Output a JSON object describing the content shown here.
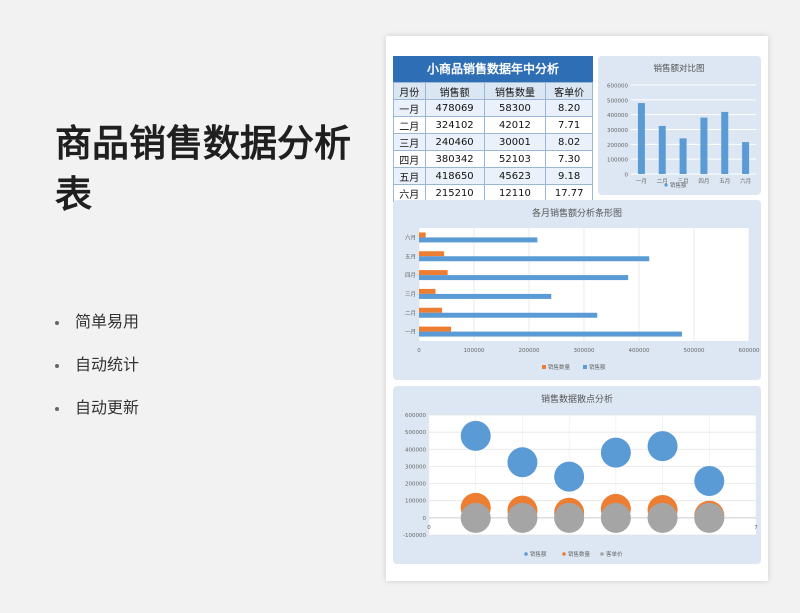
{
  "page": {
    "title": "商品销售数据分析表",
    "features": [
      "简单易用",
      "自动统计",
      "自动更新"
    ]
  },
  "table": {
    "title": "小商品销售数据年中分析",
    "headers": [
      "月份",
      "销售额",
      "销售数量",
      "客单价"
    ],
    "rows": [
      [
        "一月",
        "478069",
        "58300",
        "8.20"
      ],
      [
        "二月",
        "324102",
        "42012",
        "7.71"
      ],
      [
        "三月",
        "240460",
        "30001",
        "8.02"
      ],
      [
        "四月",
        "380342",
        "52103",
        "7.30"
      ],
      [
        "五月",
        "418650",
        "45623",
        "9.18"
      ],
      [
        "六月",
        "215210",
        "12110",
        "17.77"
      ]
    ]
  },
  "colors": {
    "blue": "#5b9bd5",
    "orange": "#ed7d31",
    "gray": "#a5a5a5",
    "header": "#2e6eb5"
  },
  "chart_data": [
    {
      "type": "bar",
      "title": "销售额对比图",
      "categories": [
        "一月",
        "二月",
        "三月",
        "四月",
        "五月",
        "六月"
      ],
      "series": [
        {
          "name": "销售额",
          "values": [
            478069,
            324102,
            240460,
            380342,
            418650,
            215210
          ]
        }
      ],
      "ylim": [
        0,
        600000
      ],
      "yticks": [
        "600000",
        "500000",
        "400000",
        "300000",
        "200000",
        "100000",
        "0"
      ],
      "legend": "bottom",
      "grid": true
    },
    {
      "type": "bar",
      "orientation": "horizontal",
      "title": "各月销售额分析条形图",
      "categories": [
        "一月",
        "二月",
        "三月",
        "四月",
        "五月",
        "六月"
      ],
      "series": [
        {
          "name": "销售数量",
          "values": [
            58300,
            42012,
            30001,
            52103,
            45623,
            12110
          ]
        },
        {
          "name": "销售额",
          "values": [
            478069,
            324102,
            240460,
            380342,
            418650,
            215210
          ]
        }
      ],
      "xlim": [
        0,
        600000
      ],
      "xticks": [
        "0",
        "100000",
        "200000",
        "300000",
        "400000",
        "500000",
        "600000"
      ],
      "legend": "bottom",
      "grid": true
    },
    {
      "type": "scatter",
      "title": "销售数据散点分析",
      "x": [
        1,
        2,
        3,
        4,
        5,
        6
      ],
      "series": [
        {
          "name": "销售额",
          "values": [
            478069,
            324102,
            240460,
            380342,
            418650,
            215210
          ]
        },
        {
          "name": "销售数量",
          "values": [
            58300,
            42012,
            30001,
            52103,
            45623,
            12110
          ]
        },
        {
          "name": "客单价",
          "values": [
            8.2,
            7.71,
            8.02,
            7.3,
            9.18,
            17.77
          ]
        }
      ],
      "xlim": [
        0,
        7
      ],
      "ylim": [
        -100000,
        600000
      ],
      "xticks": [
        "0",
        "1",
        "2",
        "3",
        "4",
        "5",
        "6",
        "7"
      ],
      "yticks": [
        "600000",
        "500000",
        "400000",
        "300000",
        "200000",
        "100000",
        "0",
        "-100000"
      ],
      "legend": "bottom",
      "grid": true
    }
  ]
}
